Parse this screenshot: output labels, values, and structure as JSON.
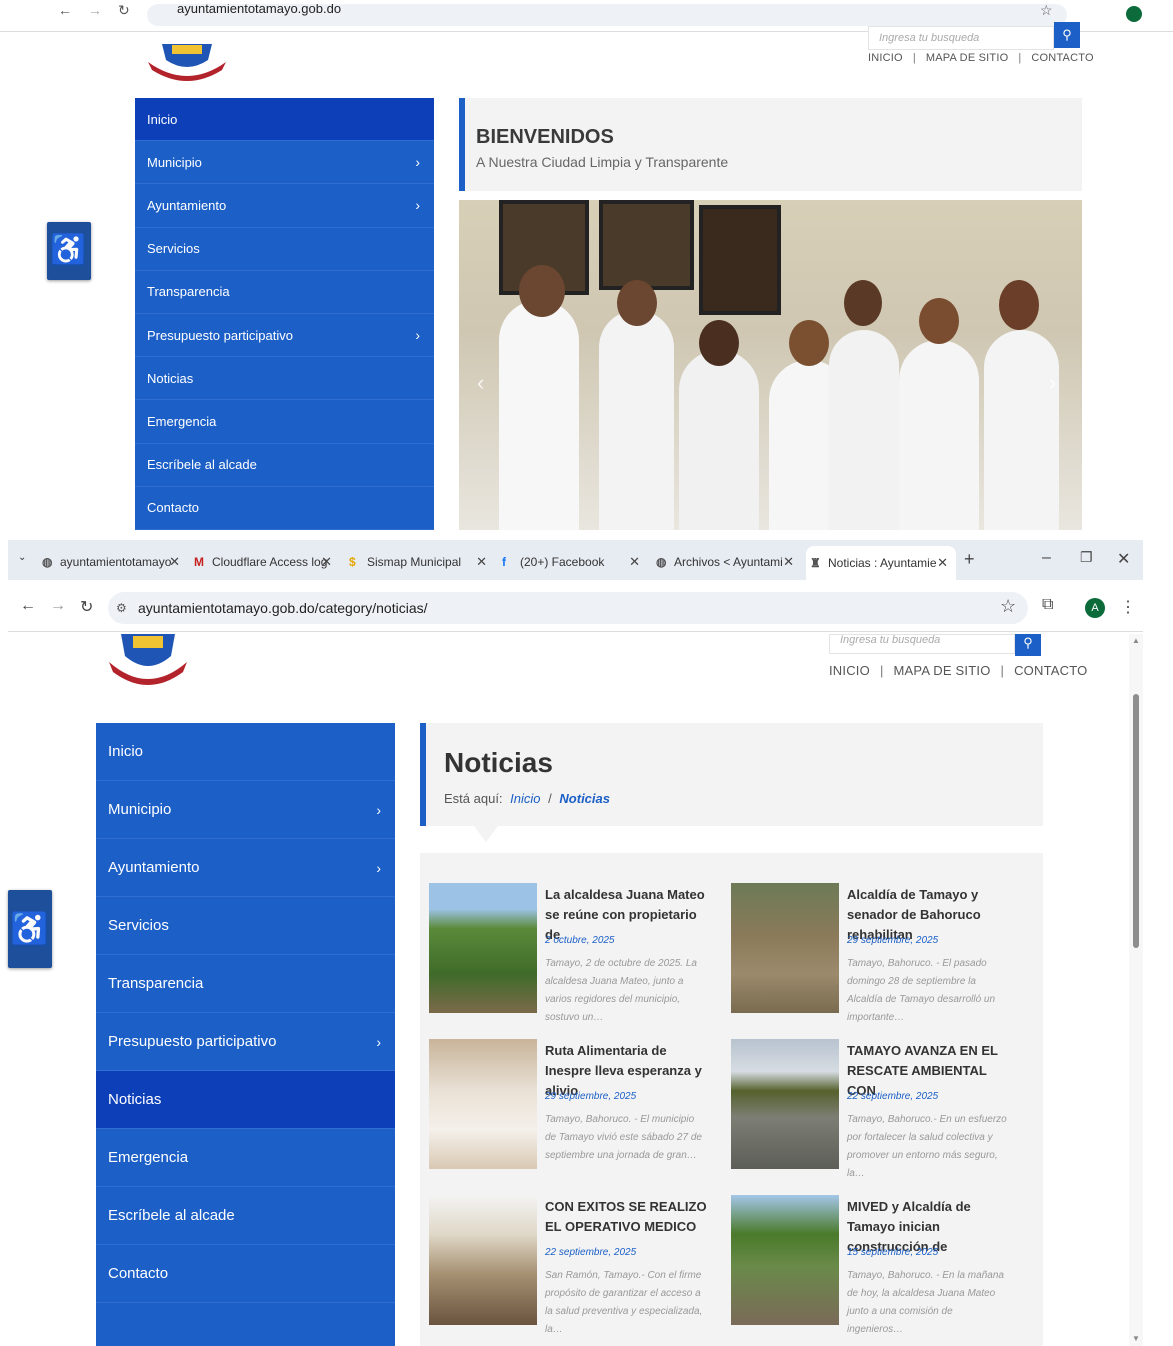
{
  "top_browser": {
    "url": "ayuntamientotamayo.gob.do"
  },
  "site": {
    "search_placeholder": "Ingresa tu busqueda",
    "top_links": [
      "INICIO",
      "MAPA DE SITIO",
      "CONTACTO"
    ],
    "menu": [
      {
        "label": "Inicio",
        "has_sub": false
      },
      {
        "label": "Municipio",
        "has_sub": true
      },
      {
        "label": "Ayuntamiento",
        "has_sub": true
      },
      {
        "label": "Servicios",
        "has_sub": false
      },
      {
        "label": "Transparencia",
        "has_sub": false
      },
      {
        "label": "Presupuesto participativo",
        "has_sub": true
      },
      {
        "label": "Noticias",
        "has_sub": false
      },
      {
        "label": "Emergencia",
        "has_sub": false
      },
      {
        "label": "Escríbele al alcade",
        "has_sub": false
      },
      {
        "label": "Contacto",
        "has_sub": false
      }
    ]
  },
  "home": {
    "title": "BIENVENIDOS",
    "subtitle": "A Nuestra Ciudad Limpia y Transparente"
  },
  "browser": {
    "tabs": [
      {
        "title": "ayuntamientotamayo",
        "icon": "globe-icon"
      },
      {
        "title": "Cloudflare Access log",
        "icon": "gmail-icon"
      },
      {
        "title": "Sismap Municipal",
        "icon": "dollar-icon"
      },
      {
        "title": "(20+) Facebook",
        "icon": "facebook-icon"
      },
      {
        "title": "Archivos < Ayuntami",
        "icon": "globe-icon"
      },
      {
        "title": "Noticias : Ayuntamie",
        "icon": "crest-icon"
      }
    ],
    "url": "ayuntamientotamayo.gob.do/category/noticias/",
    "profile_initial": "A"
  },
  "noticias": {
    "title": "Noticias",
    "breadcrumb_prefix": "Está aquí:",
    "breadcrumb_home": "Inicio",
    "breadcrumb_sep": "/",
    "breadcrumb_current": "Noticias",
    "items": [
      {
        "title": "La alcaldesa Juana Mateo se reúne con propietario de",
        "date": "2 octubre, 2025",
        "excerpt": "Tamayo, 2 de octubre de 2025. La alcaldesa Juana Mateo, junto a varios regidores del municipio, sostuvo un…"
      },
      {
        "title": "Alcaldía de Tamayo y senador de Bahoruco rehabilitan",
        "date": "29 septiembre, 2025",
        "excerpt": "Tamayo, Bahoruco. - El pasado domingo 28 de septiembre la Alcaldía de Tamayo desarrolló un importante…"
      },
      {
        "title": "Ruta Alimentaria de Inespre lleva esperanza y alivio",
        "date": "29 septiembre, 2025",
        "excerpt": "Tamayo, Bahoruco. - El municipio de Tamayo vivió este sábado 27 de septiembre una jornada de gran…"
      },
      {
        "title": "TAMAYO AVANZA EN EL RESCATE AMBIENTAL CON",
        "date": "22 septiembre, 2025",
        "excerpt": "Tamayo, Bahoruco.- En un esfuerzo por fortalecer la salud colectiva y promover un entorno más seguro, la…"
      },
      {
        "title": "CON EXITOS SE REALIZO EL OPERATIVO MEDICO",
        "date": "22 septiembre, 2025",
        "excerpt": "San Ramón, Tamayo.- Con el firme propósito de garantizar el acceso a la salud preventiva y especializada, la…"
      },
      {
        "title": "MIVED y Alcaldía de Tamayo inician construcción de",
        "date": "15 septiembre, 2025",
        "excerpt": "Tamayo, Bahoruco. - En la mañana de hoy, la alcaldesa Juana Mateo junto a una comisión de ingenieros…"
      }
    ]
  }
}
